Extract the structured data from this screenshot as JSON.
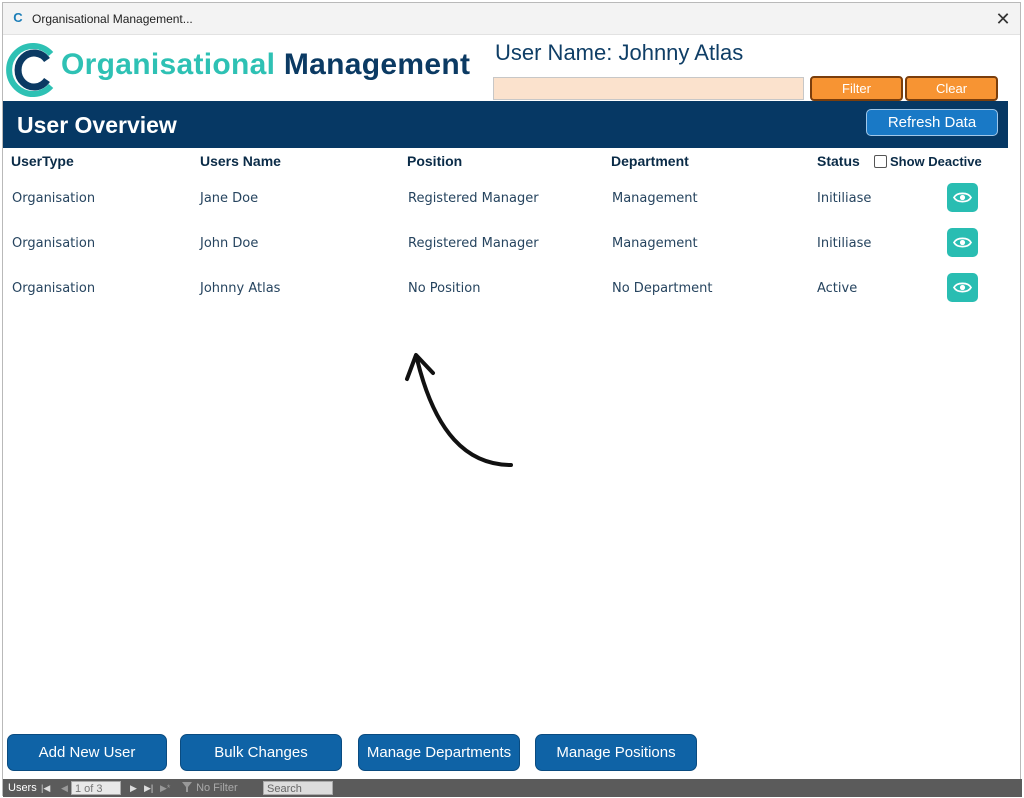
{
  "window": {
    "title": "Organisational Management...",
    "close_glyph": "✕",
    "app_icon_letter": "C"
  },
  "header": {
    "logo": {
      "word1": "Organisational",
      "word2": "Management",
      "icon": "c-logo-icon",
      "accent_teal": "#2ec1b4",
      "accent_navy": "#0b3a63"
    },
    "user_name_label": "User Name: Johnny Atlas",
    "filter_input": {
      "value": "",
      "placeholder": ""
    },
    "filter_button": "Filter",
    "clear_button": "Clear"
  },
  "banner": {
    "title": "User Overview",
    "refresh_button": "Refresh Data",
    "color": "#063864"
  },
  "table": {
    "columns": [
      "UserType",
      "Users Name",
      "Position",
      "Department",
      "Status"
    ],
    "show_deactive_label": "Show Deactive",
    "show_deactive_checked": false,
    "rows": [
      {
        "user_type": "Organisation",
        "name": "Jane Doe",
        "position": "Registered Manager",
        "department": "Management",
        "status": "Initiliase",
        "action_icon": "eye-icon"
      },
      {
        "user_type": "Organisation",
        "name": "John Doe",
        "position": "Registered Manager",
        "department": "Management",
        "status": "Initiliase",
        "action_icon": "eye-icon"
      },
      {
        "user_type": "Organisation",
        "name": "Johnny Atlas",
        "position": "No Position",
        "department": "No Department",
        "status": "Active",
        "action_icon": "eye-icon"
      }
    ]
  },
  "footer_buttons": [
    "Add New User",
    "Bulk Changes",
    "Manage Departments",
    "Manage Positions"
  ],
  "record_nav": {
    "label": "Users",
    "position": "1 of 3",
    "filter_status": "No Filter",
    "search_placeholder": "Search",
    "first_glyph": "|◀",
    "prev_glyph": "◀",
    "next_glyph": "▶",
    "last_glyph": "▶|",
    "new_glyph": "▶*"
  }
}
